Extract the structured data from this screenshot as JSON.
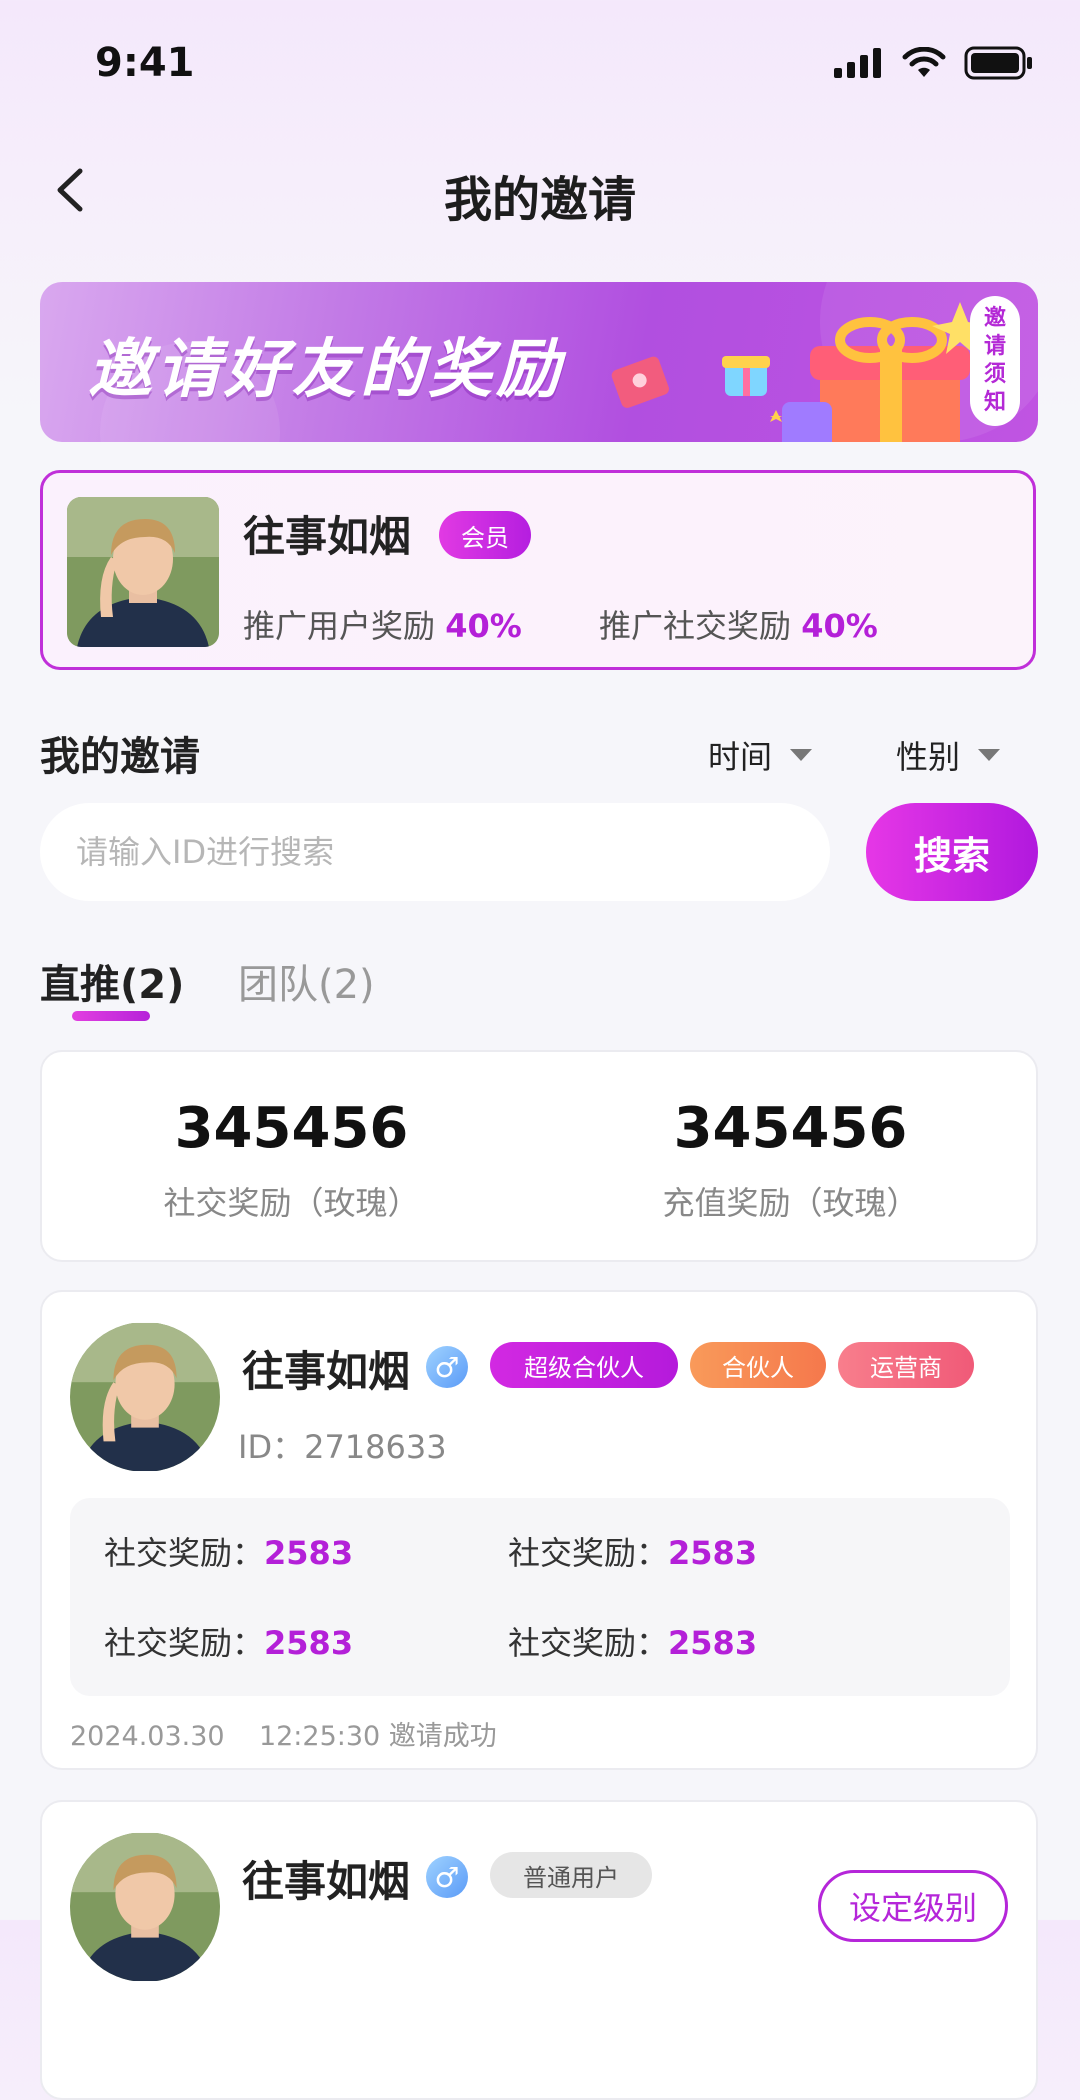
{
  "status_bar": {
    "time": "9:41"
  },
  "header": {
    "title": "我的邀请"
  },
  "banner": {
    "text": "邀请好友的奖励",
    "notice_chars": [
      "邀",
      "请",
      "须",
      "知"
    ]
  },
  "profile": {
    "name": "往事如烟",
    "badge": "会员",
    "user_reward_label": "推广用户奖励",
    "user_reward_value": "40%",
    "social_reward_label": "推广社交奖励",
    "social_reward_value": "40%"
  },
  "invites": {
    "title": "我的邀请",
    "filter_time": "时间",
    "filter_gender": "性别",
    "search_placeholder": "请输入ID进行搜索",
    "search_button": "搜索"
  },
  "tabs": [
    {
      "label": "直推(2)",
      "active": true
    },
    {
      "label": "团队(2)",
      "active": false
    }
  ],
  "totals": [
    {
      "value": "345456",
      "label": "社交奖励（玫瑰）"
    },
    {
      "value": "345456",
      "label": "充值奖励（玫瑰）"
    }
  ],
  "members": [
    {
      "name": "往事如烟",
      "gender_symbol": "♂",
      "tags": [
        "超级合伙人",
        "合伙人",
        "运营商"
      ],
      "id_text": "ID：2718633",
      "rewards": [
        {
          "label": "社交奖励：",
          "value": "2583"
        },
        {
          "label": "社交奖励：",
          "value": "2583"
        },
        {
          "label": "社交奖励：",
          "value": "2583"
        },
        {
          "label": "社交奖励：",
          "value": "2583"
        }
      ],
      "date": "2024.03.30",
      "time": "12:25:30",
      "status": "邀请成功"
    },
    {
      "name": "往事如烟",
      "gender_symbol": "♂",
      "tags": [
        "普通用户"
      ],
      "action": "设定级别"
    }
  ],
  "colors": {
    "accent": "#b420d8",
    "tag_super_partner": "#c921e0",
    "tag_partner": "#f7884f",
    "tag_operator": "#f3657f",
    "tag_normal": "#e6e6e6"
  }
}
